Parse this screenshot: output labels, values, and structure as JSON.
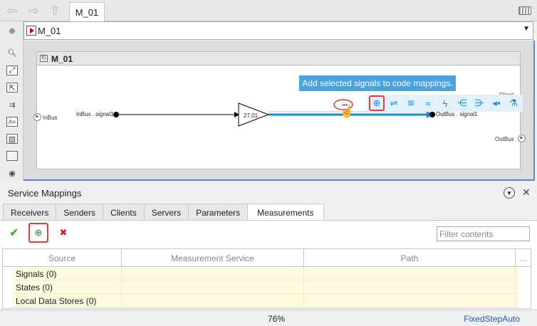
{
  "tab": {
    "title": "M_01"
  },
  "address": {
    "model": "M_01"
  },
  "canvas": {
    "subsystem_title": "M_01",
    "inport_label": "InBus",
    "outport_labels": [
      "Client",
      "OutBus"
    ],
    "signal_in": "InBus . signal1",
    "signal_out": "OutBus . signal1",
    "gain_value": "27.01",
    "tooltip": "Add selected signals to code mappings."
  },
  "service_mappings": {
    "title": "Service Mappings",
    "tabs": [
      "Receivers",
      "Senders",
      "Clients",
      "Servers",
      "Parameters",
      "Measurements"
    ],
    "active_tab": "Measurements",
    "filter_placeholder": "Filter contents",
    "columns": [
      "Source",
      "Measurement Service",
      "Path",
      "..."
    ],
    "rows": [
      "Signals (0)",
      "States (0)",
      "Local Data Stores (0)"
    ]
  },
  "status": {
    "zoom": "76%",
    "solver": "FixedStepAuto"
  },
  "colors": {
    "accent": "#1a8ad4",
    "highlight": "#e23b3b",
    "tooltip_bg": "#4aa3df",
    "row_bg": "#fdfbe0"
  },
  "icons": {
    "left_toolbar": [
      "collapse-icon",
      "zoom-in-icon",
      "fit-view-icon",
      "zoom-box-icon",
      "arrows-icon",
      "annotation-icon",
      "image-icon",
      "area-icon",
      "camera-icon"
    ],
    "quick_actions": [
      "add-signal-to-mapping-icon",
      "signal-tool-icon",
      "wireless-icon",
      "wireless-alt-icon",
      "lightning-icon",
      "bus-selector-icon",
      "bus-creator-icon",
      "bus-element-icon",
      "flask-icon"
    ]
  }
}
